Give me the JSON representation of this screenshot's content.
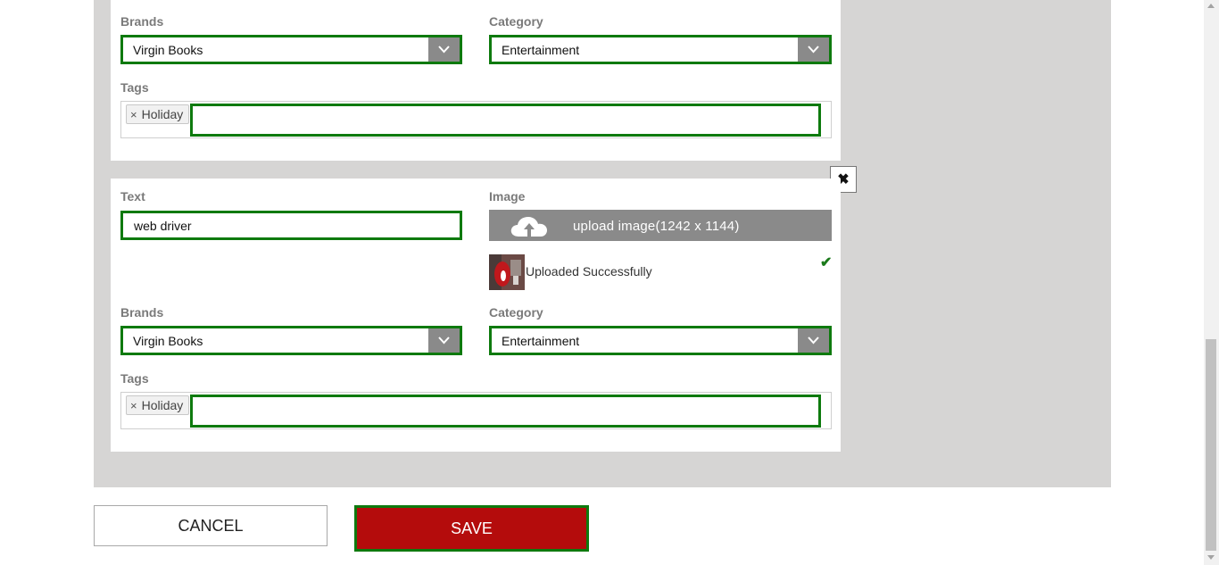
{
  "form_top": {
    "brands_label": "Brands",
    "brands_value": "Virgin Books",
    "category_label": "Category",
    "category_value": "Entertainment",
    "tags_label": "Tags",
    "tag_chip": "Holiday",
    "tag_remove_glyph": "×"
  },
  "form_bottom": {
    "text_label": "Text",
    "text_value": "web driver",
    "image_label": "Image",
    "upload_label": "upload image(1242 x 1144)",
    "upload_status": "Uploaded Successfully",
    "brands_label": "Brands",
    "brands_value": "Virgin Books",
    "category_label": "Category",
    "category_value": "Entertainment",
    "tags_label": "Tags",
    "tag_chip": "Holiday",
    "tag_remove_glyph": "×",
    "close_glyph": "✖",
    "check_glyph": "✔"
  },
  "actions": {
    "cancel_label": "CANCEL",
    "save_label": "SAVE"
  },
  "icons": {
    "dropdown": "chevron-down-icon",
    "upload": "cloud-upload-icon",
    "close": "close-icon",
    "check": "check-icon"
  },
  "colors": {
    "accent_border": "#0e7a0e",
    "save_bg": "#b40c0c",
    "panel_bg": "#d6d5d4",
    "dropdown_bg": "#8a8a8a"
  }
}
